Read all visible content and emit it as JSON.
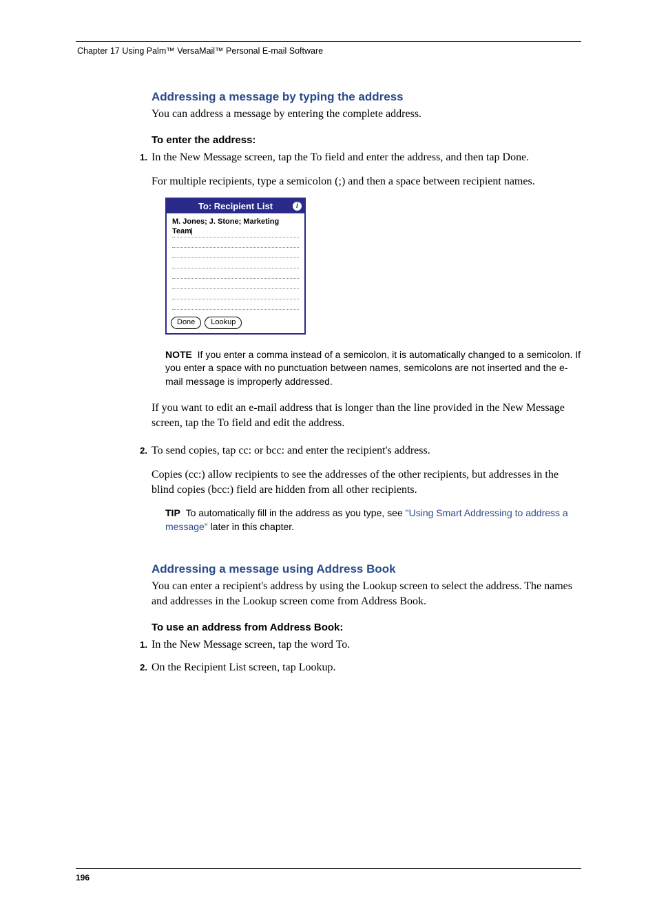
{
  "header": {
    "chapter": "Chapter 17   Using Palm™ VersaMail™ Personal E-mail Software"
  },
  "section1": {
    "heading": "Addressing a message by typing the address",
    "intro": "You can address a message by entering the complete address.",
    "subhead": "To enter the address:",
    "step1_num": "1.",
    "step1": "In the New Message screen, tap the To field and enter the address, and then tap Done.",
    "step1b": "For multiple recipients, type a semicolon (;) and then a space between recipient names."
  },
  "device": {
    "title": "To: Recipient List",
    "info": "i",
    "entry": "M. Jones; J. Stone; Marketing Team",
    "done": "Done",
    "lookup": "Lookup"
  },
  "note": {
    "label": "NOTE",
    "text": "If you enter a comma instead of a semicolon, it is automatically changed to a semicolon. If you enter a space with no punctuation between names, semicolons are not inserted and the e-mail message is improperly addressed."
  },
  "after_note": "If you want to edit an e-mail address that is longer than the line provided in the New Message screen, tap the To field and edit the address.",
  "step2": {
    "num": "2.",
    "text": "To send copies, tap cc: or bcc: and enter the recipient's address.",
    "text2": "Copies (cc:) allow recipients to see the addresses of the other recipients, but addresses in the blind copies (bcc:) field are hidden from all other recipients."
  },
  "tip": {
    "label": "TIP",
    "pre": "To automatically fill in the address as you type, see ",
    "link": "\"Using Smart Addressing to address a message\"",
    "post": " later in this chapter."
  },
  "section2": {
    "heading": "Addressing a message using Address Book",
    "intro": "You can enter a recipient's address by using the Lookup screen to select the address. The names and addresses in the Lookup screen come from Address Book.",
    "subhead": "To use an address from Address Book:",
    "s1n": "1.",
    "s1": "In the New Message screen, tap the word To.",
    "s2n": "2.",
    "s2": "On the Recipient List screen, tap Lookup."
  },
  "footer": {
    "page": "196"
  }
}
